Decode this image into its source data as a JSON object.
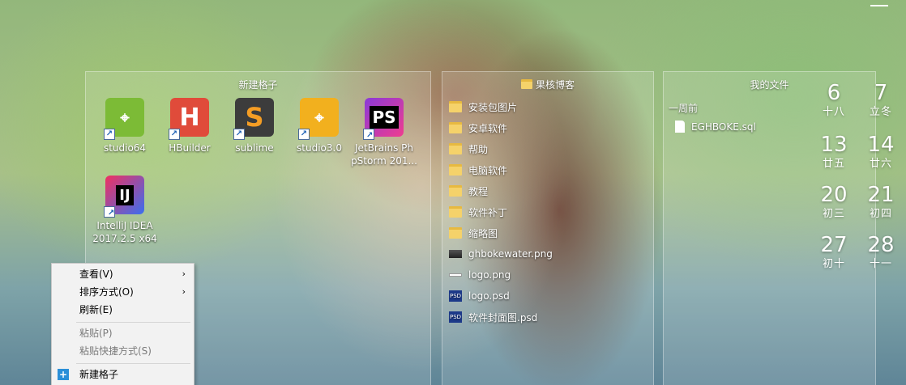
{
  "fence_grid": {
    "title": "新建格子",
    "apps": [
      {
        "label": "studio64",
        "icon": "android-studio-icon"
      },
      {
        "label": "HBuilder",
        "icon": "hbuilder-icon",
        "glyph": "H"
      },
      {
        "label": "sublime",
        "icon": "sublime-text-icon",
        "glyph": "S"
      },
      {
        "label": "studio3.0",
        "icon": "android-studio-icon"
      },
      {
        "label": "JetBrains Ph\npStorm 201...",
        "line1": "JetBrains Ph",
        "line2": "pStorm 201...",
        "icon": "phpstorm-icon",
        "glyph": "PS"
      },
      {
        "label": "IntelliJ IDEA 2017.2.5 x64",
        "line1": "IntelliJ IDEA",
        "line2": "2017.2.5 x64",
        "icon": "intellij-idea-icon",
        "glyph": "IJ"
      }
    ]
  },
  "fence_folder": {
    "title": "果核博客",
    "items": [
      {
        "name": "安装包图片",
        "icon": "folder-icon"
      },
      {
        "name": "安卓软件",
        "icon": "folder-icon"
      },
      {
        "name": "帮助",
        "icon": "folder-icon"
      },
      {
        "name": "电脑软件",
        "icon": "folder-icon"
      },
      {
        "name": "教程",
        "icon": "folder-icon"
      },
      {
        "name": "软件补丁",
        "icon": "folder-icon"
      },
      {
        "name": "缩略图",
        "icon": "folder-icon"
      },
      {
        "name": "ghbokewater.png",
        "icon": "image-icon"
      },
      {
        "name": "logo.png",
        "icon": "image-icon"
      },
      {
        "name": "logo.psd",
        "icon": "psd-icon"
      },
      {
        "name": "软件封面图.psd",
        "icon": "psd-icon"
      }
    ],
    "psd_badge": "PSD"
  },
  "fence_files": {
    "title": "我的文件",
    "section": "一周前",
    "file": "EGHBOKE.sql"
  },
  "calendar": [
    {
      "day": "6",
      "lunar": "十八"
    },
    {
      "day": "7",
      "lunar": "立冬"
    },
    {
      "day": "13",
      "lunar": "廿五"
    },
    {
      "day": "14",
      "lunar": "廿六"
    },
    {
      "day": "20",
      "lunar": "初三"
    },
    {
      "day": "21",
      "lunar": "初四"
    },
    {
      "day": "27",
      "lunar": "初十"
    },
    {
      "day": "28",
      "lunar": "十一"
    }
  ],
  "context_menu": {
    "view": "查看(V)",
    "sort": "排序方式(O)",
    "refresh": "刷新(E)",
    "paste": "粘贴(P)",
    "paste_shortcut": "粘贴快捷方式(S)",
    "new_fence": "新建格子",
    "submenu_arrow": "›",
    "plus_glyph": "+"
  },
  "shortcut_glyph": "↗"
}
